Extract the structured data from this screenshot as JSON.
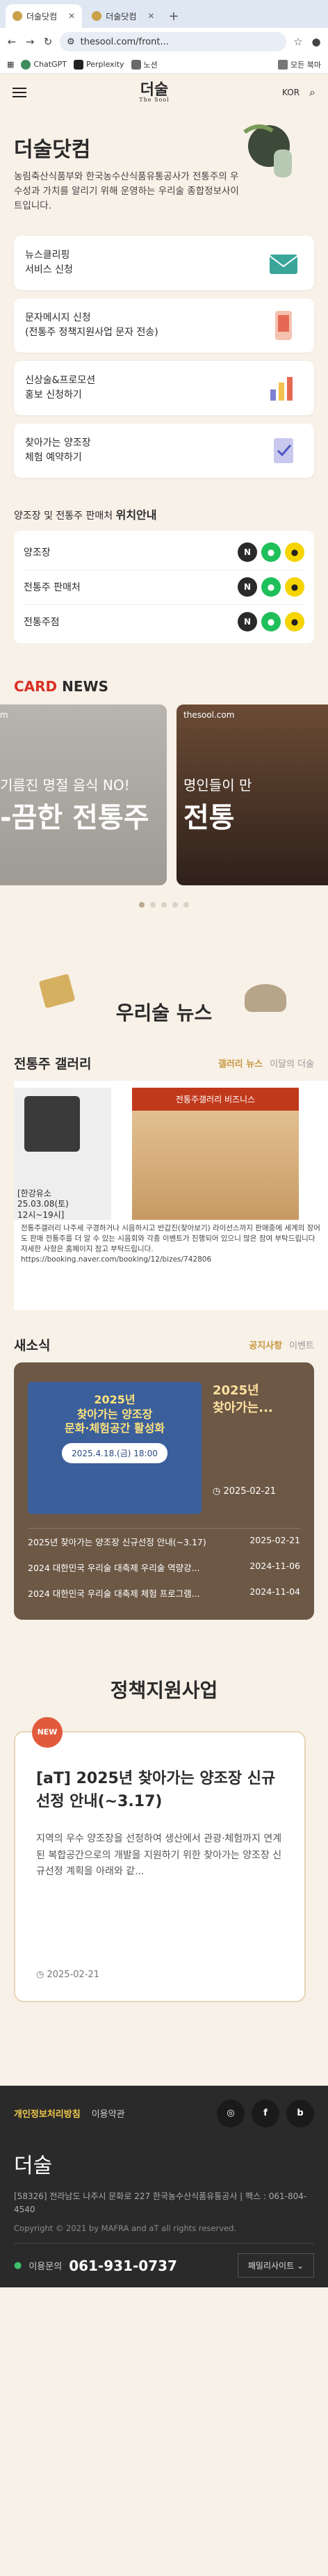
{
  "browser": {
    "tabs": [
      {
        "label": "더술닷컴"
      },
      {
        "label": "더술닷컴"
      }
    ],
    "url": "thesool.com/front...",
    "bookmarks": [
      {
        "label": "ChatGPT"
      },
      {
        "label": "Perplexity"
      },
      {
        "label": "노션"
      }
    ],
    "folder": "모든 북마"
  },
  "header": {
    "logo": "더술",
    "logo_sub": "The Sool",
    "lang": "KOR"
  },
  "hero": {
    "title": "더술닷컴",
    "desc": "농림축산식품부와 한국농수산식품유통공사가 전통주의 우수성과 가치를 알리기 위해 운영하는 우리술 종합정보사이트입니다."
  },
  "menus": [
    {
      "label": "뉴스클리핑\n서비스 신청"
    },
    {
      "label": "문자메시지 신청\n(전통주 정책지원사업 문자 전송)"
    },
    {
      "label": "신상술&프로모션\n홍보 신청하기"
    },
    {
      "label": "찾아가는 양조장\n체험 예약하기"
    }
  ],
  "locations": {
    "title_pre": "양조장 및 전통주 판매처",
    "title_bold": "위치안내",
    "rows": [
      {
        "label": "양조장"
      },
      {
        "label": "전통주 판매처"
      },
      {
        "label": "전통주점"
      }
    ]
  },
  "cardnews": {
    "title_red": "CARD",
    "title": " NEWS",
    "items": [
      {
        "site": "m",
        "l1": "기름진 명절 음식 NO!",
        "l2": "-끔한 전통주"
      },
      {
        "site": "thesool.com",
        "l1": "명인들이 만",
        "l2": "전통"
      }
    ]
  },
  "news": {
    "title": "우리술 뉴스"
  },
  "gallery": {
    "title": "전통주 갤러리",
    "tabs": [
      {
        "label": "갤러리 뉴스"
      },
      {
        "label": "이달의 더술"
      }
    ],
    "caption": "[한강유소\n25.03.08(토)\n12시~19시]",
    "banner": "전통주갤러리 비즈니스",
    "text": "전통주갤러리 나주세 구경하거나 시음하시고 반갑진(찾아보기) 라이선스까지 판매중에 세계의 장어도 판매 전통주를 더 알 수 있는 시음회와 각종 이벤트가 진행되어 있으니 많은 참여 부탁드립니다 자세한 사항은 홈페이지 참고 부탁드립니다. https://booking.naver.com/booking/12/bizes/742806"
  },
  "notice": {
    "title": "새소식",
    "tabs": [
      {
        "label": "공지사항"
      },
      {
        "label": "이벤트"
      }
    ],
    "poster_l1": "2025년\n찾아가는 양조장\n문화·체험공간 활성화",
    "poster_l2": "2025.4.18.(금) 18:00",
    "side_title": "2025년\n찾아가는...",
    "side_date": "2025-02-21",
    "list": [
      {
        "title": "2025년 찾아가는 양조장 신규선정 안내(~3.17)",
        "date": "2025-02-21"
      },
      {
        "title": "2024 대한민국 우리술 대축제 우리술 역량강...",
        "date": "2024-11-06"
      },
      {
        "title": "2024 대한민국 우리술 대축제 체험 프로그램...",
        "date": "2024-11-04"
      }
    ]
  },
  "support": {
    "title": "정책지원사업",
    "badge": "NEW",
    "card_title": "[aT] 2025년 찾아가는 양조장 신규선정 안내(~3.17)",
    "card_desc": "지역의 우수 양조장을 선정하여 생산에서 관광·체험까지 연계된 복합공간으로의 개발을 지원하기 위한 찾아가는 양조장 신규선정 계획을 아래와 같...",
    "card_date": "2025-02-21"
  },
  "footer": {
    "privacy": "개인정보처리방침",
    "terms": "이용약관",
    "sns": [
      {
        "label": "◎"
      },
      {
        "label": "f"
      },
      {
        "label": "b"
      }
    ],
    "logo": "더술",
    "address": "[58326] 전라남도 나주시 문화로 227 한국농수산식품유통공사 | 팩스 : 061-804-4540",
    "copyright": "Copyright © 2021 by MAFRA and aT all rights reserved.",
    "tel_label": "이용문의",
    "tel": "061-931-0737",
    "family": "패밀리사이트"
  }
}
